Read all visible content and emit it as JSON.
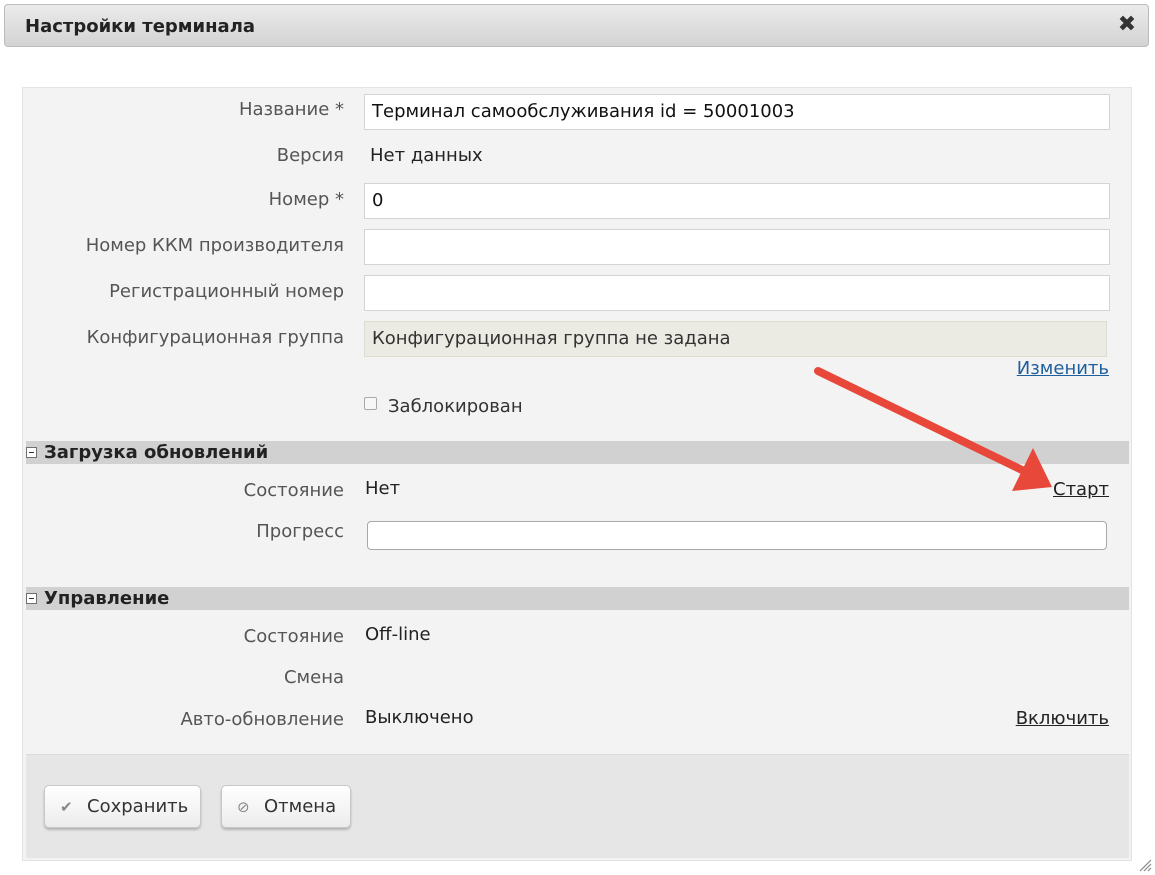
{
  "dialog": {
    "title": "Настройки терминала",
    "close_glyph": "✖"
  },
  "form": {
    "name": {
      "label": "Название *",
      "value": "Терминал самообслуживания id = 50001003"
    },
    "version": {
      "label": "Версия",
      "value": "Нет данных"
    },
    "number": {
      "label": "Номер *",
      "value": "0"
    },
    "kkm_number": {
      "label": "Номер ККМ производителя",
      "value": ""
    },
    "reg_number": {
      "label": "Регистрационный номер",
      "value": ""
    },
    "config_group": {
      "label": "Конфигурационная группа",
      "value": "Конфигурационная группа не задана",
      "change_link": "Изменить"
    },
    "blocked": {
      "label": "Заблокирован",
      "checked": false
    }
  },
  "updates": {
    "title": "Загрузка обновлений",
    "status": {
      "label": "Состояние",
      "value": "Нет",
      "action": "Старт"
    },
    "progress": {
      "label": "Прогресс",
      "percent": 0
    }
  },
  "control": {
    "title": "Управление",
    "status": {
      "label": "Состояние",
      "value": "Off-line"
    },
    "shift": {
      "label": "Смена",
      "value": ""
    },
    "auto_update": {
      "label": "Авто-обновление",
      "value": "Выключено",
      "action": "Включить"
    }
  },
  "footer": {
    "save": {
      "label": "Сохранить",
      "icon": "check-icon"
    },
    "cancel": {
      "label": "Отмена",
      "icon": "cancel-icon"
    }
  },
  "colors": {
    "annotation_arrow": "#e8483a",
    "link": "#1f5f9e",
    "section_bar": "#d1d1d1"
  }
}
